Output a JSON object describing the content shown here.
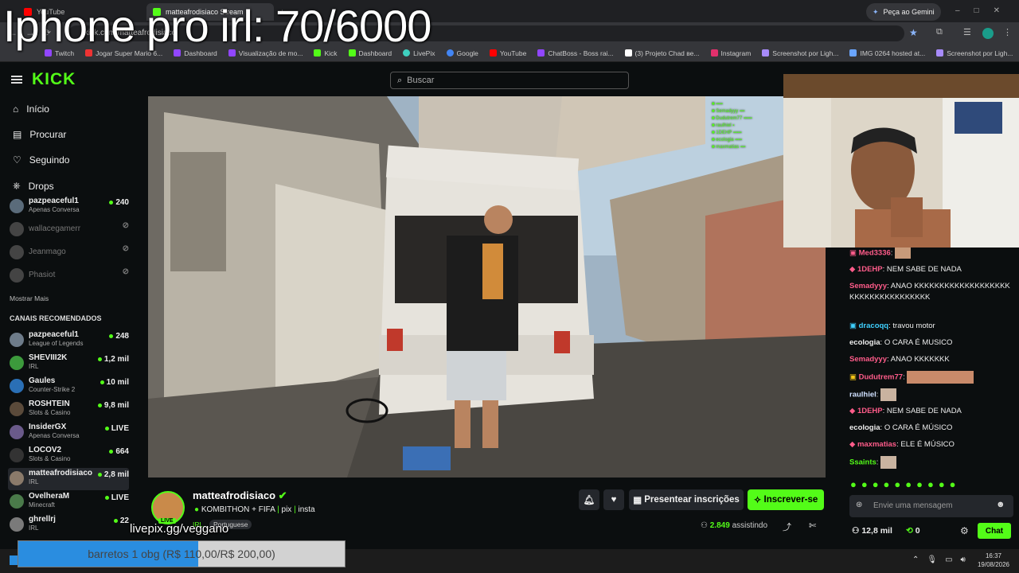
{
  "overlay": {
    "title": "Iphone pro irl: 70/6000",
    "livepix": "livepix.gg/veggano"
  },
  "donation": {
    "text": "barretos 1 obg (R$ 110,00/R$ 200,00)",
    "progress": 0.55
  },
  "browser": {
    "tabs": [
      {
        "label": "YouTube"
      },
      {
        "label": "matteafrodisiaco Stream"
      }
    ],
    "new_tab": "+",
    "gemini": "Peça ao Gemini",
    "url": "kick.com/matteafrodisiaco",
    "bookmarks": [
      "Twitch",
      "Jogar Super Mario 6...",
      "Dashboard",
      "Visualização de mo...",
      "Kick",
      "Dashboard",
      "LivePix",
      "Google",
      "YouTube",
      "ChatBoss - Boss rai...",
      "(3) Projeto Chad ве...",
      "Instagram",
      "Screenshot por Ligh...",
      "IMG 0264 hosted at...",
      "Screenshot por Ligh..."
    ]
  },
  "kick": {
    "logo": "KICK",
    "search_placeholder": "Buscar",
    "nav": [
      {
        "label": "Início",
        "icon": "home-icon"
      },
      {
        "label": "Procurar",
        "icon": "browse-icon"
      },
      {
        "label": "Seguindo",
        "icon": "heart-icon"
      },
      {
        "label": "Drops",
        "icon": "drops-icon"
      }
    ],
    "followed": [
      {
        "name": "pazpeaceful1",
        "category": "Apenas Conversa",
        "viewers": "240",
        "live": true
      },
      {
        "name": "wallacegamerr",
        "live": false
      },
      {
        "name": "Jeanmago",
        "live": false
      },
      {
        "name": "Phasiot",
        "live": false
      }
    ],
    "show_more": "Mostrar Mais",
    "recommended_title": "CANAIS RECOMENDADOS",
    "recommended": [
      {
        "name": "pazpeaceful1",
        "category": "League of Legends",
        "viewers": "248"
      },
      {
        "name": "SHEVIII2K",
        "category": "IRL",
        "viewers": "1,2 mil"
      },
      {
        "name": "Gaules",
        "category": "Counter-Strike 2",
        "viewers": "10 mil"
      },
      {
        "name": "ROSHTEIN",
        "category": "Slots & Casino",
        "viewers": "9,8 mil"
      },
      {
        "name": "InsiderGX",
        "category": "Apenas Conversa",
        "viewers": "LIVE"
      },
      {
        "name": "LOCOV2",
        "category": "Slots & Casino",
        "viewers": "664"
      },
      {
        "name": "matteafrodisiaco",
        "category": "IRL",
        "viewers": "2,8 mil"
      },
      {
        "name": "OvelheraM",
        "category": "Minecraft",
        "viewers": "LIVE"
      },
      {
        "name": "ghrellrj",
        "category": "IRL",
        "viewers": "22"
      }
    ]
  },
  "stream": {
    "streamer": "matteafrodisiaco",
    "title": "KOMBITHON + FIFA",
    "links": [
      "pix",
      "insta"
    ],
    "category": "IRL",
    "language": "Portuguese",
    "live_badge": "LIVE",
    "viewers": "2.849",
    "viewers_label": "assistindo",
    "gift_label": "Presentear inscrições",
    "subscribe_label": "Inscrever-se"
  },
  "chat": {
    "messages": [
      {
        "user": "Med3336",
        "text": "",
        "color": "#ff5c8a"
      },
      {
        "user": "1DEHP",
        "text": "NEM SABE DE NADA",
        "color": "#ff5c8a"
      },
      {
        "user": "Semadyyy",
        "text": "ANAO KKKKKKKKKKKKKKKKKKKKKKKKKKKKKKKKKKK",
        "color": "#ff5c8a"
      },
      {
        "user": "dracoqq",
        "text": "travou motor",
        "color": "#3fd0ff"
      },
      {
        "user": "ecologia",
        "text": "O CARA É MUSICO",
        "color": "#e8e8e8"
      },
      {
        "user": "Semadyyy",
        "text": "ANAO KKKKKKK",
        "color": "#ff5c8a"
      },
      {
        "user": "Dudutrem77",
        "text": "",
        "color": "#ff5c8a"
      },
      {
        "user": "raulhiel",
        "text": "",
        "color": "#e8e8e8"
      },
      {
        "user": "1DEHP",
        "text": "NEM SABE DE NADA",
        "color": "#ff5c8a"
      },
      {
        "user": "ecologia",
        "text": "O CARA É MÚSICO",
        "color": "#e8e8e8"
      },
      {
        "user": "maxmatias",
        "text": "ELE É MÚSICO",
        "color": "#e8e8e8"
      },
      {
        "user": "Ssaints",
        "text": "",
        "color": "#53fc18"
      }
    ],
    "input_placeholder": "Envie uma mensagem",
    "followers": "12,8 mil",
    "points": "0",
    "chat_button": "Chat"
  },
  "taskbar": {
    "time": "16:37",
    "date": "19/08/2026"
  },
  "colors": {
    "accent": "#53fc18",
    "bg": "#0b0e0f"
  }
}
